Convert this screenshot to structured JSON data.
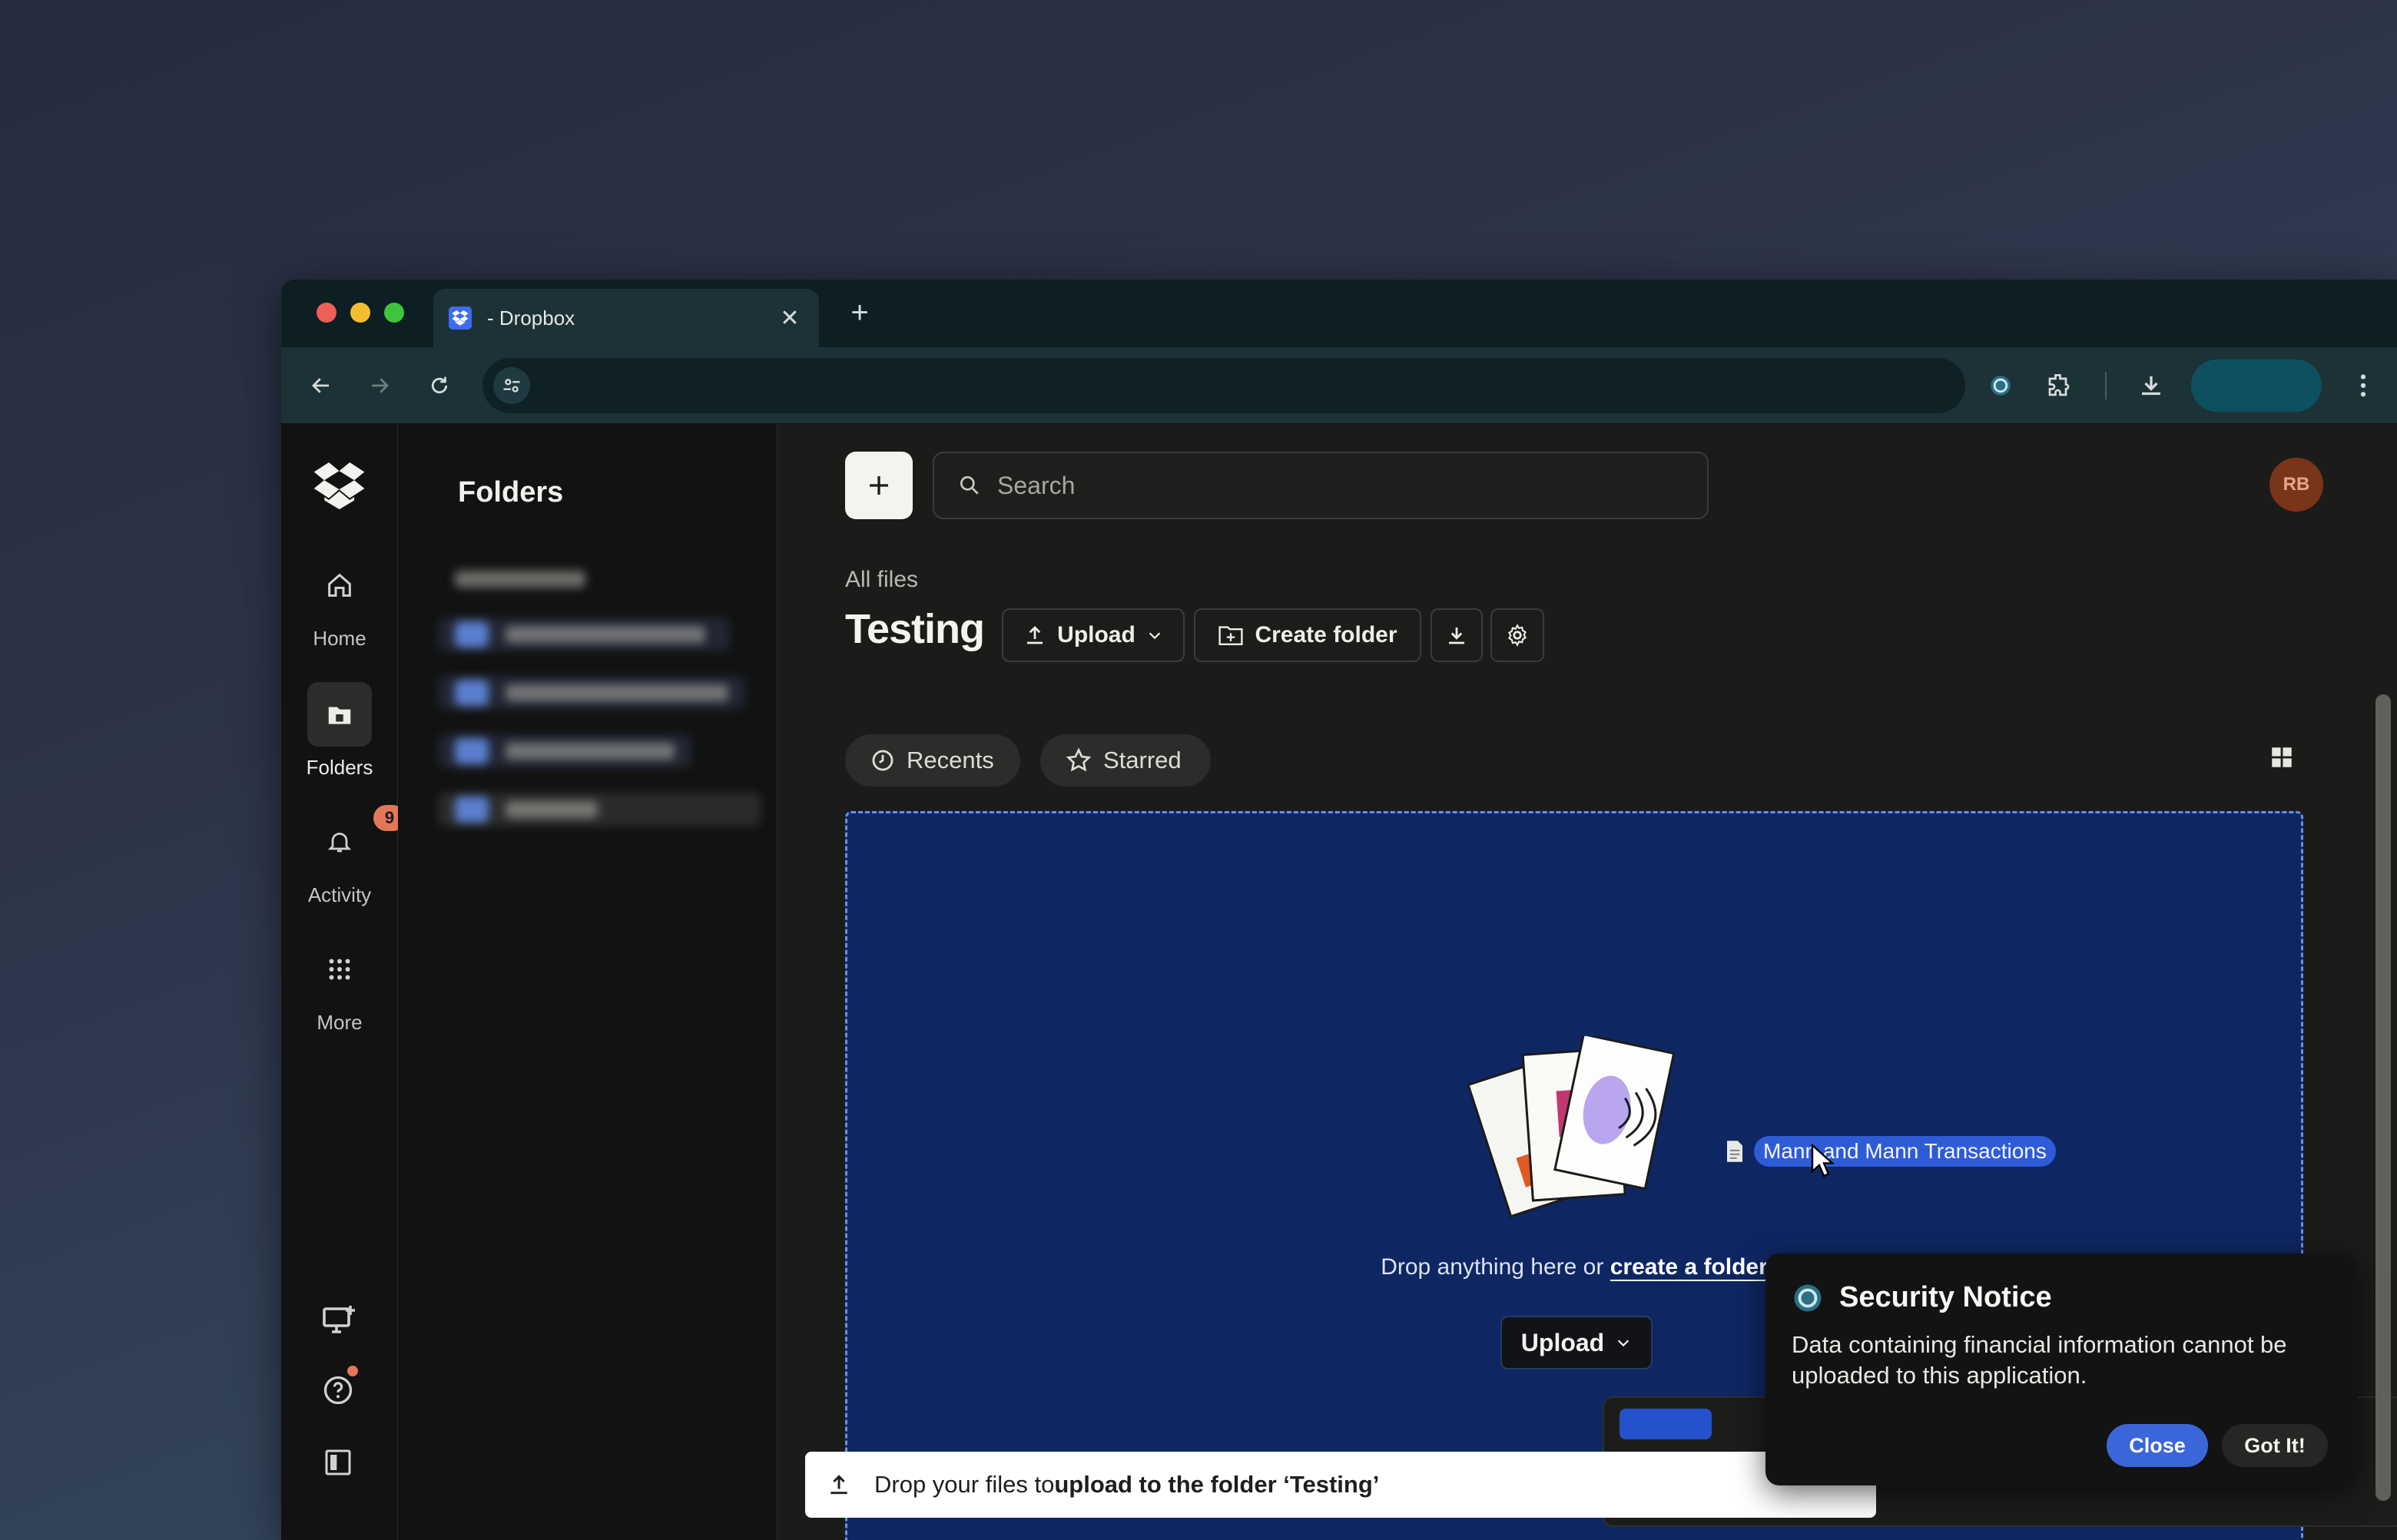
{
  "browser": {
    "tab_title": "- Dropbox",
    "tab_close_glyph": "✕",
    "new_tab_glyph": "+",
    "address_value": ""
  },
  "rail": {
    "items": [
      {
        "label": "Home",
        "icon": "home-icon"
      },
      {
        "label": "Folders",
        "icon": "folder-icon",
        "active": true
      },
      {
        "label": "Activity",
        "icon": "bell-icon",
        "badge": "9"
      },
      {
        "label": "More",
        "icon": "grid-icon"
      }
    ]
  },
  "folders_panel": {
    "title": "Folders"
  },
  "header": {
    "search_placeholder": "Search",
    "avatar_initials": "RB"
  },
  "page": {
    "breadcrumb": "All files",
    "title": "Testing",
    "upload_label": "Upload",
    "create_folder_label": "Create folder"
  },
  "filters": {
    "recents": "Recents",
    "starred": "Starred"
  },
  "dropzone": {
    "dragged_file": "Mann and Mann Transactions",
    "text_prefix": "Drop anything here or ",
    "text_link": "create a folder",
    "upload_label": "Upload"
  },
  "toast": {
    "prefix": "Drop your files to ",
    "bold": "upload to the folder ‘Testing’"
  },
  "security_notice": {
    "title": "Security Notice",
    "body": "Data containing financial information cannot be uploaded to this application.",
    "close_label": "Close",
    "got_it_label": "Got It!"
  },
  "colors": {
    "dropzone_bg": "#0e2763",
    "accent_blue": "#3b66d9",
    "badge": "#e2775a",
    "avatar": "#7a3418"
  }
}
